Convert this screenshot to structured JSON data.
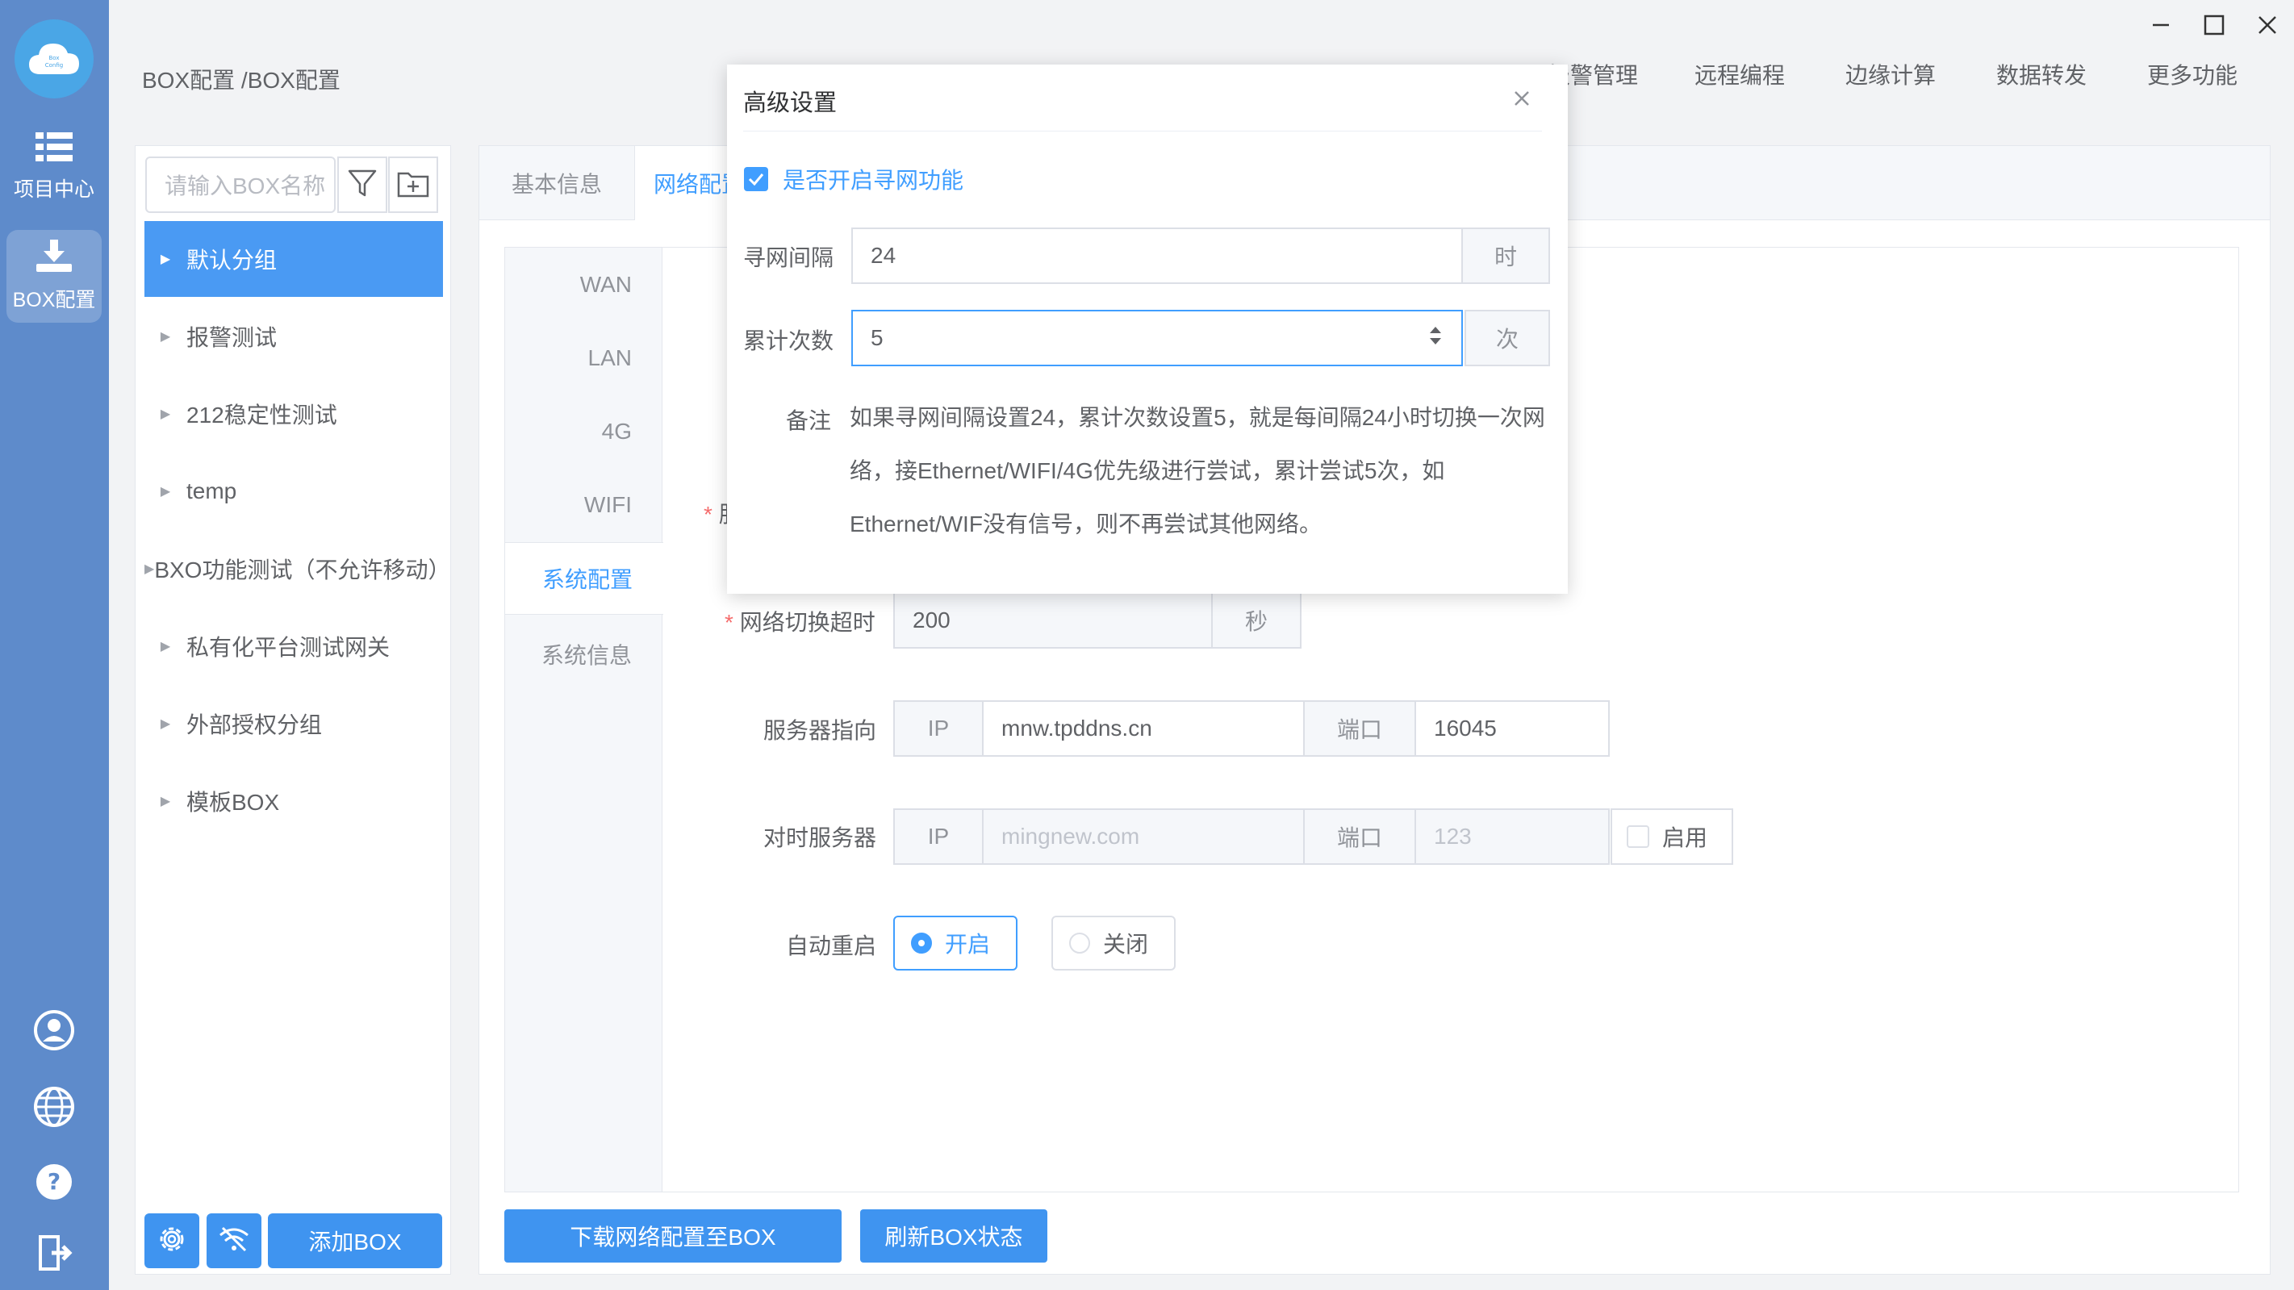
{
  "rail": {
    "logo_text": "Box Config",
    "items": [
      {
        "label": "项目中心",
        "icon": "list-icon"
      },
      {
        "label": "BOX配置",
        "icon": "download-icon"
      }
    ],
    "bottom_icons": [
      "user-icon",
      "globe-icon",
      "help-icon",
      "logout-icon"
    ]
  },
  "header": {
    "breadcrumb": "BOX配置 /BOX配置",
    "nav": [
      "报警管理",
      "远程编程",
      "边缘计算",
      "数据转发",
      "更多功能"
    ]
  },
  "groups": {
    "search_placeholder": "请输入BOX名称",
    "items": [
      "默认分组",
      "报警测试",
      "212稳定性测试",
      "temp",
      "BXO功能测试（不允许移动）",
      "私有化平台测试网关",
      "外部授权分组",
      "模板BOX"
    ],
    "add_box_label": "添加BOX"
  },
  "tabs": {
    "basic": "基本信息",
    "network": "网络配置"
  },
  "vtabs": [
    "WAN",
    "LAN",
    "4G",
    "WIFI",
    "系统配置",
    "系统信息"
  ],
  "form": {
    "hidden_label_fragment": "服",
    "switch_timeout": {
      "label": "网络切换超时",
      "value": "200",
      "unit": "秒"
    },
    "server": {
      "label": "服务器指向",
      "ip_addon": "IP",
      "ip": "mnw.tpddns.cn",
      "port_addon": "端口",
      "port": "16045"
    },
    "time_server": {
      "label": "对时服务器",
      "ip_addon": "IP",
      "ip": "mingnew.com",
      "port_addon": "端口",
      "port": "123",
      "enable_label": "启用"
    },
    "auto_restart": {
      "label": "自动重启",
      "on": "开启",
      "off": "关闭"
    }
  },
  "buttons": {
    "download": "下载网络配置至BOX",
    "refresh": "刷新BOX状态"
  },
  "dialog": {
    "title": "高级设置",
    "checkbox_label": "是否开启寻网功能",
    "interval": {
      "label": "寻网间隔",
      "value": "24",
      "unit": "时"
    },
    "count": {
      "label": "累计次数",
      "value": "5",
      "unit": "次"
    },
    "note_label": "备注",
    "note_lines": [
      "如果寻网间隔设置24，累计次数设置5，就是每间隔24小时切换一次网",
      "络，接Ethernet/WIFI/4G优先级进行尝试，累计尝试5次，如",
      "Ethernet/WIF没有信号，则不再尝试其他网络。"
    ]
  },
  "colors": {
    "rail": "#5e8bcb",
    "primary": "#409eff",
    "button": "#3f94f0"
  }
}
